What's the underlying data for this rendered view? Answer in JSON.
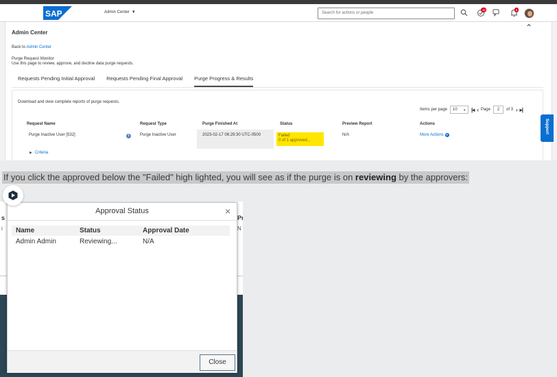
{
  "shell": {
    "logo_text": "SAP",
    "menu_label": "Admin Center",
    "search_placeholder": "Search for actions or people",
    "notification_badges": [
      "10",
      "8"
    ],
    "colors": {
      "brand": "#0a6ed1",
      "badge": "#d6001c"
    }
  },
  "page": {
    "title": "Admin Center",
    "back_prefix": "Back to",
    "back_link": "Admin Center",
    "monitor_title": "Purge Request Monitor",
    "monitor_desc": "Use this page to review, approve, and decline data purge requests.",
    "tabs": [
      {
        "label": "Requests Pending Initial Approval"
      },
      {
        "label": "Requests Pending Final Approval"
      },
      {
        "label": "Purge Progress & Results"
      }
    ],
    "download_text": "Download and view complete reports of purge requests.",
    "paging": {
      "items_per_page_label": "Items per page",
      "items_per_page": "10",
      "page_label": "Page",
      "page": "2",
      "of_label": "of 3"
    },
    "table": {
      "headers": [
        "Request Name",
        "Request Type",
        "Purge Finished At",
        "Status",
        "Preview Report",
        "Actions"
      ],
      "row": {
        "name": "Purge Inactive User [532]",
        "type": "Purge Inactive User",
        "finished": "2023-02-17 06:29:30 UTC-0500",
        "status": "Failed",
        "approved": "0 of 1 approved...",
        "preview": "N/A",
        "actions": "More Actions"
      }
    },
    "criteria": "Criteria",
    "support": "Support",
    "status_highlight_color": "#ffe600"
  },
  "caption": {
    "pre": "If you click the approved below the \"Failed\" high lighted, you will see as if the purge is on ",
    "bold": "reviewing",
    "post": " by the approvers:"
  },
  "dialog": {
    "background_fragments": {
      "left_header": "s",
      "right_header": "Pr",
      "left_cell": "i",
      "right_cell": "N"
    },
    "title": "Approval Status",
    "headers": [
      "Name",
      "Status",
      "Approval Date"
    ],
    "row": {
      "name": "Admin Admin",
      "status": "Reviewing...",
      "date": "N/A"
    },
    "close_label": "Close"
  }
}
